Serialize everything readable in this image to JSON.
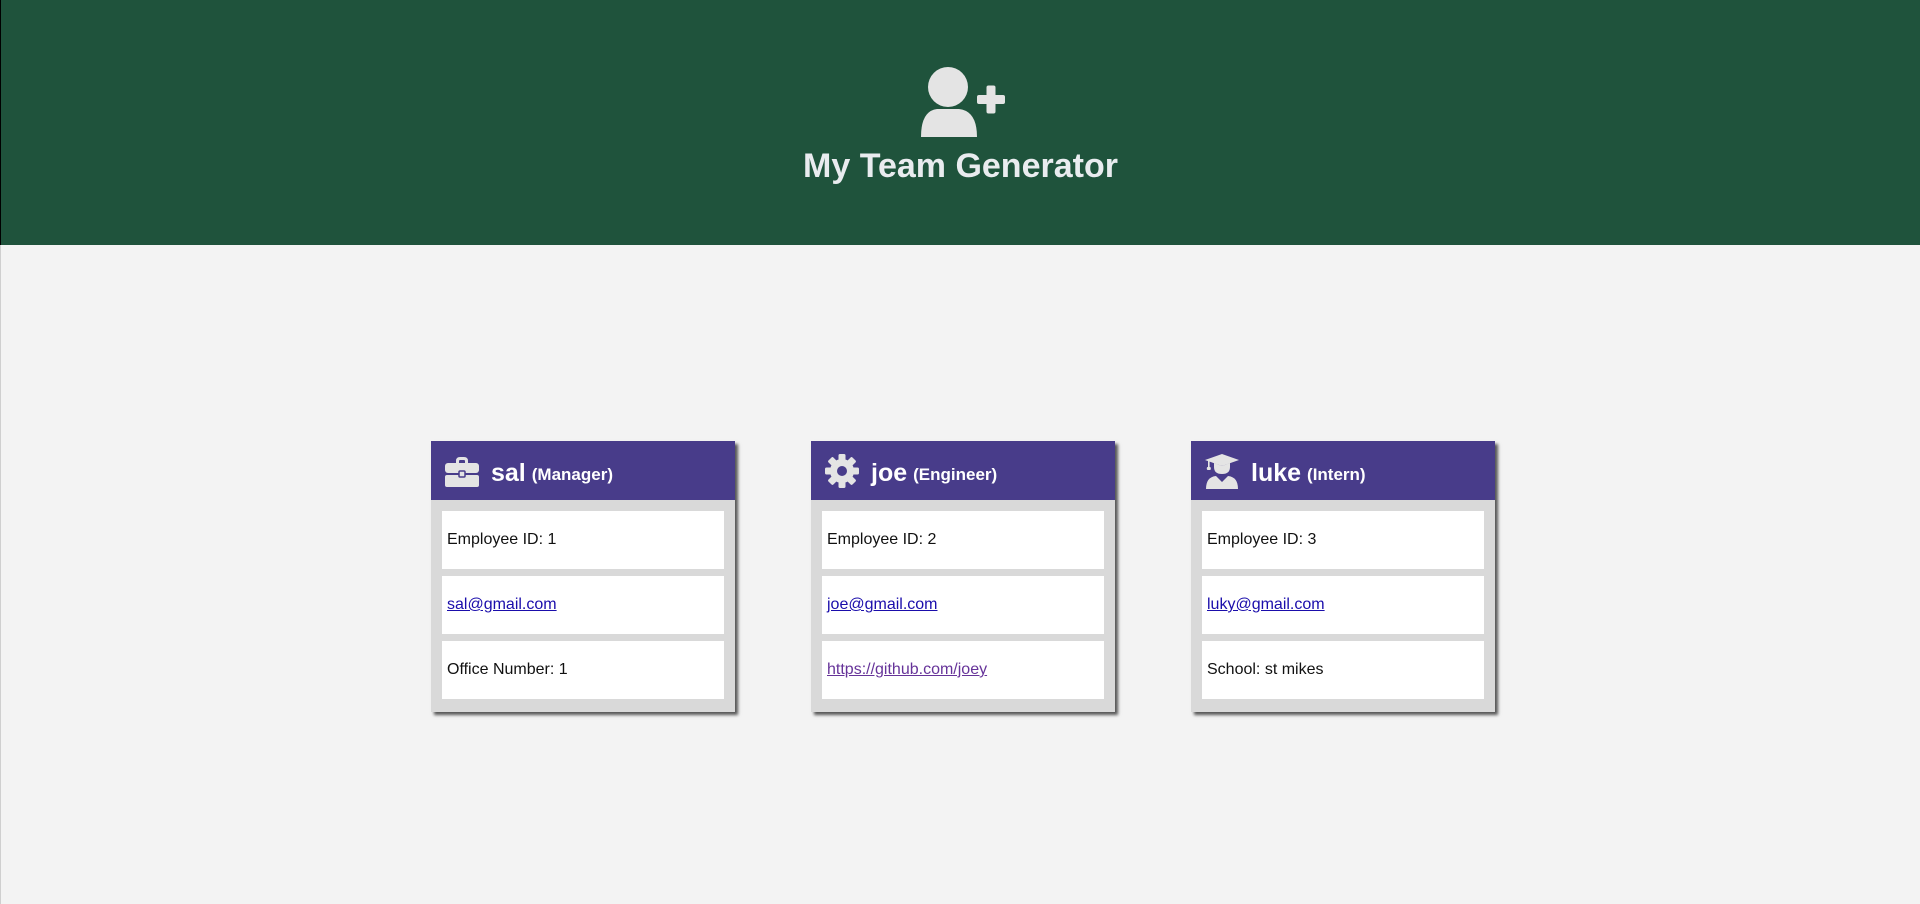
{
  "header": {
    "title": "My Team Generator",
    "icon": "user-plus-icon",
    "background": "#1f533c"
  },
  "colors": {
    "card_header": "#483c8a",
    "link": "#1a0dab",
    "visited_link": "#663399"
  },
  "cards": [
    {
      "name": "sal",
      "role": "(Manager)",
      "icon": "briefcase-icon",
      "id_text": "Employee ID: 1",
      "email": "sal@gmail.com",
      "extra": "Office Number: 1"
    },
    {
      "name": "joe",
      "role": "(Engineer)",
      "icon": "gear-icon",
      "id_text": "Employee ID: 2",
      "email": "joe@gmail.com",
      "extra": "https://github.com/joey"
    },
    {
      "name": "luke",
      "role": "(Intern)",
      "icon": "graduate-icon",
      "id_text": "Employee ID: 3",
      "email": "luky@gmail.com",
      "extra": "School: st mikes"
    }
  ]
}
